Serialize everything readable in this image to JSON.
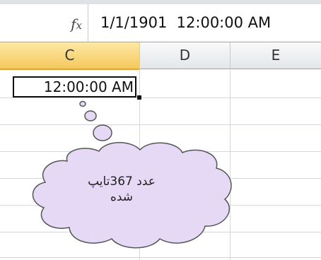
{
  "formula_bar": {
    "fx_label": "fx",
    "value": "1/1/1901  12:00:00 AM"
  },
  "columns": [
    {
      "label": "C",
      "selected": true
    },
    {
      "label": "D",
      "selected": false
    },
    {
      "label": "E",
      "selected": false
    }
  ],
  "active_cell": {
    "column": "C",
    "value": "12:00:00 AM"
  },
  "callout": {
    "line1": "عدد 367تایپ",
    "line2": "شده",
    "fill_color": "#e6d9f5",
    "border_color": "#555555"
  },
  "colors": {
    "selected_header": "#f5c85c",
    "grid_line": "#d4d7db"
  }
}
